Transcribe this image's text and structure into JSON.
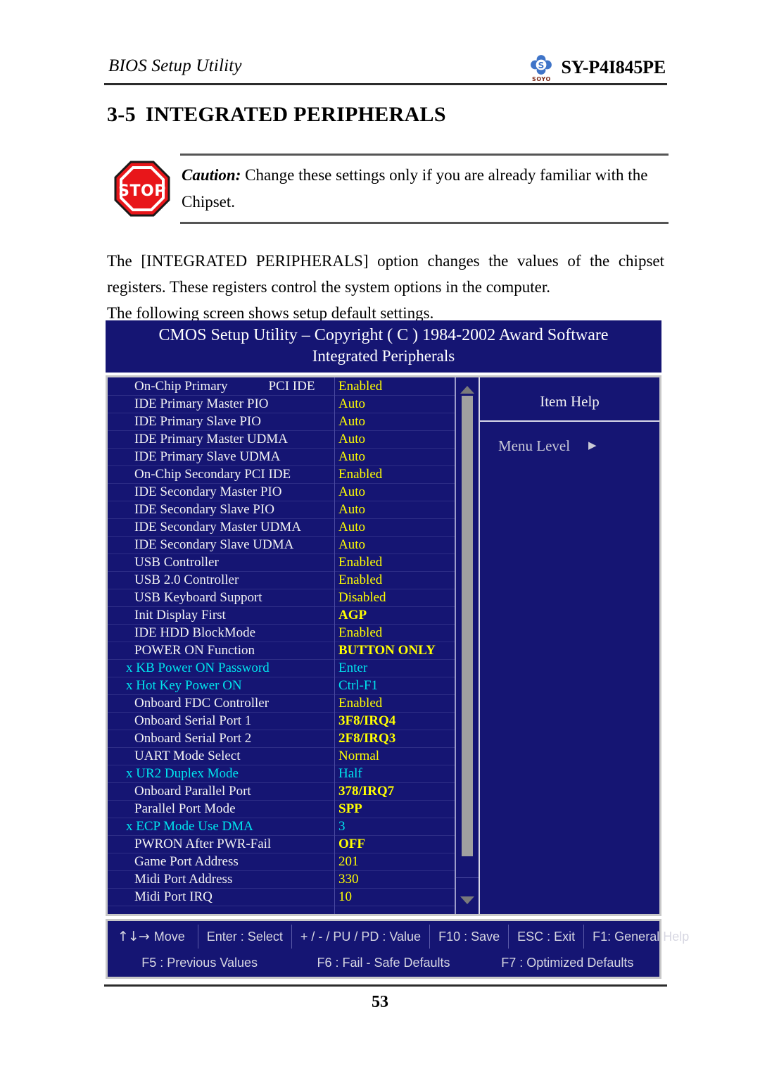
{
  "header": {
    "title": "BIOS Setup Utility",
    "model": "SY-P4I845PE",
    "logo_wordmark": "SOYO"
  },
  "section": {
    "number": "3-5",
    "title": "INTEGRATED PERIPHERALS"
  },
  "caution": {
    "lead": "Caution:",
    "text": " Change these settings only if you are already familiar with the Chipset.",
    "icon_label": "STOP"
  },
  "intro": {
    "paragraph1": "The [INTEGRATED PERIPHERALS] option changes the values of the chipset registers. These registers control the system options in the computer.",
    "paragraph2": "The following screen shows setup default settings."
  },
  "bios": {
    "title_line1": "CMOS Setup Utility – Copyright ( C ) 1984-2002 Award Software",
    "title_line2": "Integrated Peripherals",
    "help": {
      "title": "Item Help",
      "menu_level_label": "Menu Level",
      "caret": "▶"
    },
    "scrollbar": {
      "up_arrow": "up-arrow",
      "down_arrow": "down-arrow"
    },
    "options": [
      {
        "label": "On-Chip Primary",
        "label2": "PCI IDE",
        "value": "Enabled",
        "style": "normal"
      },
      {
        "label": "IDE Primary Master PIO",
        "value": "Auto",
        "style": "normal"
      },
      {
        "label": "IDE Primary Slave PIO",
        "value": "Auto",
        "style": "normal"
      },
      {
        "label": "IDE Primary Master UDMA",
        "value": "Auto",
        "style": "normal"
      },
      {
        "label": "IDE Primary Slave UDMA",
        "value": "Auto",
        "style": "normal"
      },
      {
        "label": "On-Chip Secondary PCI IDE",
        "value": "Enabled",
        "style": "normal"
      },
      {
        "label": "IDE Secondary Master PIO",
        "value": "Auto",
        "style": "normal"
      },
      {
        "label": "IDE Secondary Slave PIO",
        "value": "Auto",
        "style": "normal"
      },
      {
        "label": "IDE Secondary Master UDMA",
        "value": "Auto",
        "style": "normal"
      },
      {
        "label": "IDE Secondary Slave UDMA",
        "value": "Auto",
        "style": "normal"
      },
      {
        "label": "USB Controller",
        "value": "Enabled",
        "style": "normal"
      },
      {
        "label": "USB 2.0 Controller",
        "value": "Enabled",
        "style": "normal"
      },
      {
        "label": "USB Keyboard Support",
        "value": "Disabled",
        "style": "normal"
      },
      {
        "label": "Init Display First",
        "value": "AGP",
        "style": "bold"
      },
      {
        "label": "IDE HDD BlockMode",
        "value": "Enabled",
        "style": "normal"
      },
      {
        "label": "POWER ON Function",
        "value": "BUTTON ONLY",
        "style": "bold"
      },
      {
        "label": "x KB Power ON Password",
        "value": "Enter",
        "style": "dim"
      },
      {
        "label": "x Hot Key Power ON",
        "value": "Ctrl-F1",
        "style": "dim"
      },
      {
        "label": "Onboard FDC Controller",
        "value": "Enabled",
        "style": "normal"
      },
      {
        "label": "Onboard Serial Port 1",
        "value": "3F8/IRQ4",
        "style": "bold"
      },
      {
        "label": "Onboard Serial Port 2",
        "value": "2F8/IRQ3",
        "style": "bold"
      },
      {
        "label": "UART Mode Select",
        "value": "Normal",
        "style": "normal"
      },
      {
        "label": "x UR2 Duplex Mode",
        "value": "Half",
        "style": "dim"
      },
      {
        "label": "Onboard Parallel Port",
        "value": "378/IRQ7",
        "style": "bold"
      },
      {
        "label": "Parallel Port Mode",
        "value": "SPP",
        "style": "bold"
      },
      {
        "label": "x ECP Mode Use DMA",
        "value": "3",
        "style": "dim"
      },
      {
        "label": "PWRON After PWR-Fail",
        "value": "OFF",
        "style": "bold"
      },
      {
        "label": "Game Port Address",
        "value": "201",
        "style": "normal"
      },
      {
        "label": "Midi Port Address",
        "value": "330",
        "style": "normal"
      },
      {
        "label": "Midi Port IRQ",
        "value": "10",
        "style": "normal"
      }
    ],
    "footer": {
      "row1": [
        {
          "arrows": "↑↓→",
          "label": "Move"
        },
        {
          "label": "Enter : Select"
        },
        {
          "label": "+ / - / PU / PD : Value"
        },
        {
          "label": "F10 : Save"
        },
        {
          "label": "ESC : Exit"
        },
        {
          "label": "F1: General Help"
        }
      ],
      "row2": [
        "F5 : Previous Values",
        "F6 : Fail - Safe Defaults",
        "F7 : Optimized Defaults"
      ]
    }
  },
  "page_number": "53",
  "colors": {
    "bios_bg": "#151573",
    "value_yellow": "#ffff00",
    "dim_cyan": "#00e5ee",
    "label_white": "#f2f2f2",
    "stop_red": "#e8161a",
    "logo_blue": "#3f74c8"
  }
}
